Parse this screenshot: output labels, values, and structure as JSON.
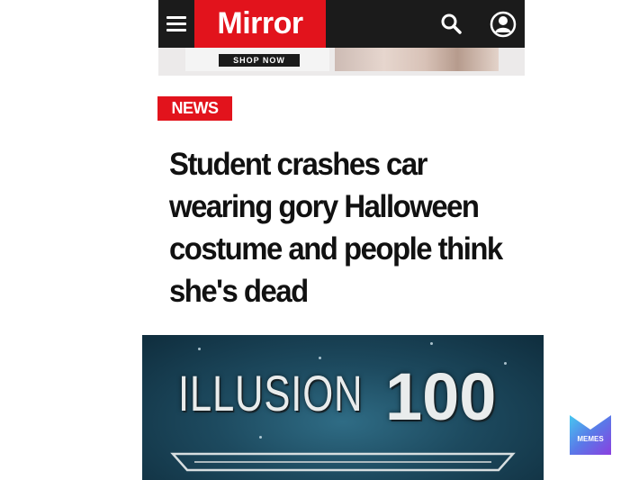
{
  "header": {
    "menu_icon": "hamburger-menu-icon",
    "logo_text": "Mirror",
    "search_icon": "search-icon",
    "account_icon": "user-account-icon",
    "bar_color": "#1b1b1b",
    "brand_color": "#e2131c"
  },
  "ad": {
    "cta_label": "SHOP NOW"
  },
  "article": {
    "section_tag": "NEWS",
    "headline": "Student crashes car wearing gory Halloween costume and people think she's dead"
  },
  "game_banner": {
    "skill_name": "ILLUSION",
    "skill_level": "100"
  },
  "watermark": {
    "label": "MEMES"
  }
}
